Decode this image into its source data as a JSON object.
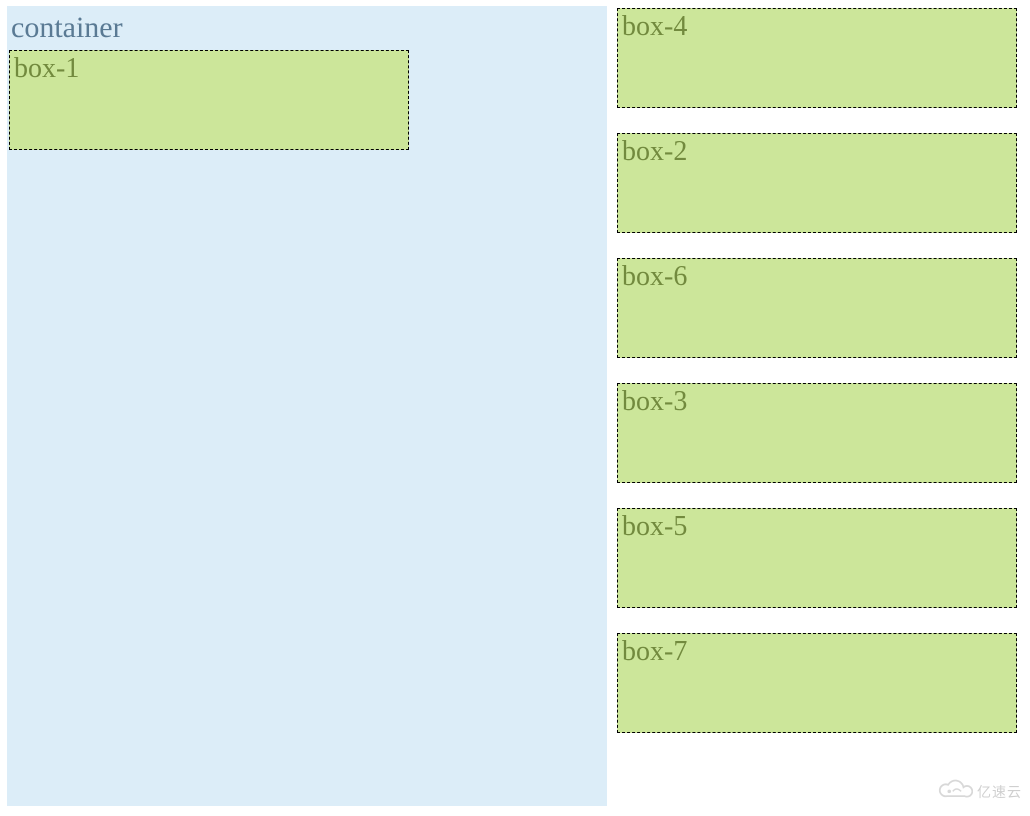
{
  "container": {
    "label": "container",
    "box": {
      "label": "box-1"
    }
  },
  "rightColumn": {
    "boxes": [
      {
        "label": "box-4"
      },
      {
        "label": "box-2"
      },
      {
        "label": "box-6"
      },
      {
        "label": "box-3"
      },
      {
        "label": "box-5"
      },
      {
        "label": "box-7"
      }
    ]
  },
  "watermark": {
    "text": "亿速云"
  }
}
